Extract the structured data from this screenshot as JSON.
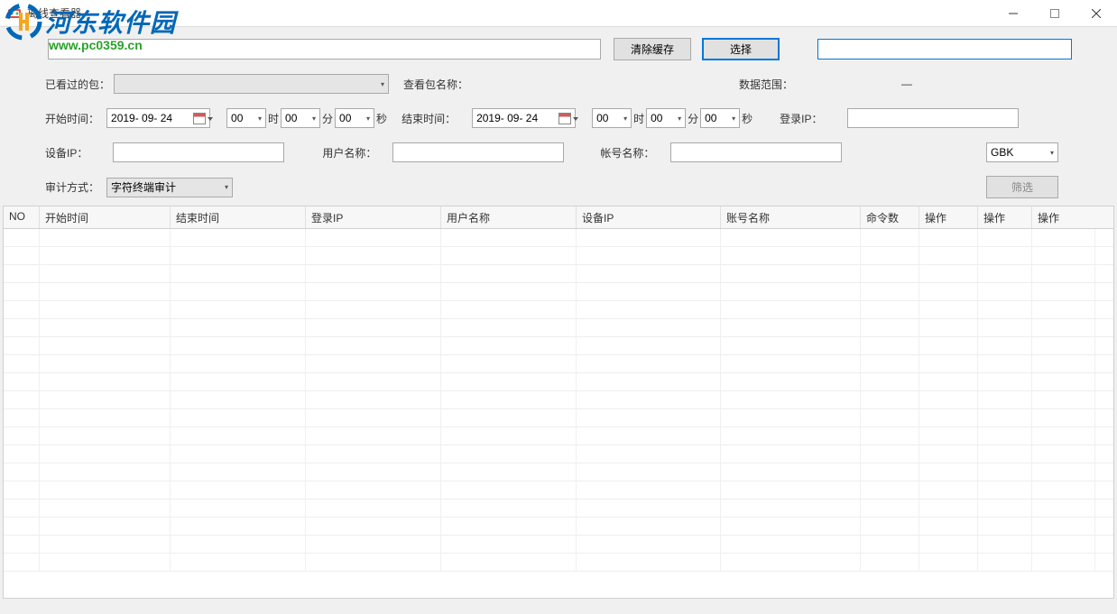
{
  "window": {
    "title": "离线查看器"
  },
  "watermark": {
    "brand": "河东软件园",
    "url": "www.pc0359.cn"
  },
  "toolbar": {
    "clear_cache": "清除缓存",
    "choose": "选择"
  },
  "filters": {
    "seen_pkg_label": "已看过的包：",
    "view_pkg_name_label": "查看包名称：",
    "data_range_label": "数据范围：",
    "data_range_value": "—",
    "start_time_label": "开始时间：",
    "start_date": "2019- 09- 24",
    "start_h": "00",
    "h_unit": "时",
    "start_m": "00",
    "m_unit": "分",
    "start_s": "00",
    "s_unit": "秒",
    "end_time_label": "结束时间：",
    "end_date": "2019- 09- 24",
    "end_h": "00",
    "end_m": "00",
    "end_s": "00",
    "login_ip_label": "登录IP：",
    "device_ip_label": "设备IP：",
    "user_name_label": "用户名称：",
    "account_name_label": "帐号名称：",
    "encoding": "GBK",
    "audit_method_label": "审计方式：",
    "audit_method_value": "字符终端审计",
    "filter_btn": "筛选"
  },
  "grid": {
    "headers": [
      "NO",
      "开始时间",
      "结束时间",
      "登录IP",
      "用户名称",
      "设备IP",
      "账号名称",
      "命令数",
      "操作",
      "操作",
      "操作"
    ]
  }
}
